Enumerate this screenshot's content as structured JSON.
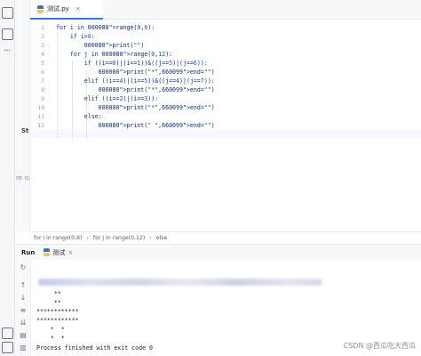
{
  "editor_tab": {
    "label": "测试.py",
    "close": "×"
  },
  "side_labels": {
    "structure": "Str",
    "truncated": "re is"
  },
  "code_lines": [
    "for i in range(0,6):",
    "    if i>0:",
    "        print(\"\")",
    "    for j in range(0,12):",
    "        if ((i==0)|(i==1))&((j==5)|(j==6)):",
    "            print(\"*\",end=\"\")",
    "        elif ((i==4)|(i==5))&((j==4)|(j==7)):",
    "            print(\"*\",end=\"\")",
    "        elif ((i==2)|(i==3)):",
    "            print(\"*\",end=\"\")",
    "        else:",
    "            print(\" \",end=\"\")"
  ],
  "line_numbers": [
    "1",
    "2",
    "3",
    "4",
    "5",
    "6",
    "7",
    "8",
    "9",
    "10",
    "11",
    "12"
  ],
  "breadcrumb": [
    "for i in range(0,6)",
    "for j in range(0,12)",
    "else"
  ],
  "run_panel": {
    "title": "Run",
    "tab_label": "测试",
    "tab_close": "×"
  },
  "console_lines": [
    "     **",
    "     **",
    "************",
    "************",
    "    *  *",
    "    *  *",
    "Process finished with exit code 0"
  ],
  "watermark": "CSDN @西瓜吃大西瓜",
  "colors": {
    "accent": "#3574f0",
    "code": "#0a2b8a",
    "string": "#067d17"
  }
}
